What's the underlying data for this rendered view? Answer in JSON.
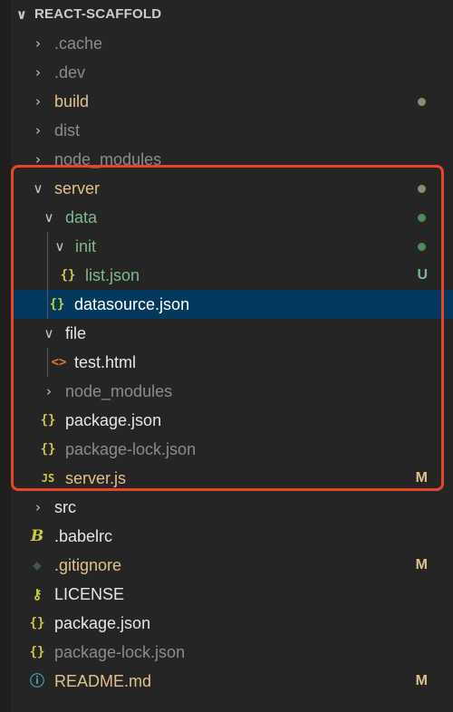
{
  "colors": {
    "sidebar_bg": "#252526",
    "selected_bg": "#04395e",
    "modified": "#e2c08d",
    "untracked": "#81b88b",
    "ignored": "#8b8b8b",
    "highlight_border": "#e8442a"
  },
  "explorer": {
    "root_label": "REACT-SCAFFOLD",
    "items": [
      {
        "label": ".cache",
        "icon": "chevron-right-icon"
      },
      {
        "label": ".dev",
        "icon": "chevron-right-icon"
      },
      {
        "label": "build",
        "icon": "chevron-right-icon",
        "status": "modified-dot"
      },
      {
        "label": "dist",
        "icon": "chevron-right-icon"
      },
      {
        "label": "node_modules",
        "icon": "chevron-right-icon"
      },
      {
        "label": "server",
        "icon": "chevron-down-icon",
        "status": "modified-dot"
      },
      {
        "label": "data",
        "icon": "chevron-down-icon",
        "status": "untracked-dot"
      },
      {
        "label": "init",
        "icon": "chevron-down-icon",
        "status": "untracked-dot"
      },
      {
        "label": "list.json",
        "icon": "json-icon",
        "badge": "U"
      },
      {
        "label": "datasource.json",
        "icon": "json-icon",
        "selected": true
      },
      {
        "label": "file",
        "icon": "chevron-down-icon"
      },
      {
        "label": "test.html",
        "icon": "html-icon"
      },
      {
        "label": "node_modules",
        "icon": "chevron-right-icon"
      },
      {
        "label": "package.json",
        "icon": "json-icon"
      },
      {
        "label": "package-lock.json",
        "icon": "json-icon"
      },
      {
        "label": "server.js",
        "icon": "js-icon",
        "badge": "M"
      },
      {
        "label": "src",
        "icon": "chevron-right-icon"
      },
      {
        "label": ".babelrc",
        "icon": "babel-icon"
      },
      {
        "label": ".gitignore",
        "icon": "git-icon",
        "badge": "M"
      },
      {
        "label": "LICENSE",
        "icon": "license-icon"
      },
      {
        "label": "package.json",
        "icon": "json-icon"
      },
      {
        "label": "package-lock.json",
        "icon": "json-icon"
      },
      {
        "label": "README.md",
        "icon": "info-icon",
        "badge": "M"
      }
    ]
  }
}
